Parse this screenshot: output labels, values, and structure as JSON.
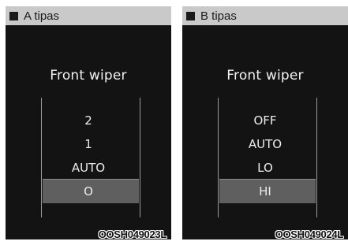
{
  "panels": [
    {
      "header": "A tipas",
      "screen_title": "Front wiper",
      "options": [
        "2",
        "1",
        "AUTO"
      ],
      "selected_option": "O",
      "caption": "OOSH049023L"
    },
    {
      "header": "B tipas",
      "screen_title": "Front wiper",
      "options": [
        "OFF",
        "AUTO",
        "LO"
      ],
      "selected_option": "HI",
      "caption": "OOSH049024L"
    }
  ],
  "colors": {
    "header_bg": "#c9c9c9",
    "screen_bg": "#131313",
    "selection_bg": "#5f5f5f",
    "text_light": "#ededed"
  },
  "icons": {
    "legend": "black-square-icon"
  }
}
